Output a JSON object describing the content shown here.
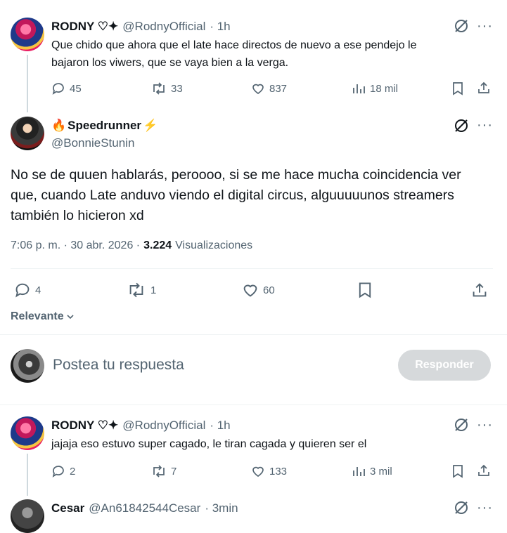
{
  "reply1": {
    "name": "RODNY ♡✦",
    "handle": "@RodnyOfficial",
    "time": "· 1h",
    "text_line1": "Que chido que ahora que el late hace directos de nuevo a ese pendejo le",
    "text_line2": "bajaron los viwers, que se vaya bien a la verga.",
    "replies": "45",
    "reposts": "33",
    "likes": "837",
    "views": "18 mil"
  },
  "main": {
    "name": "Speedrunner",
    "name_prefix": "🔥",
    "name_suffix": "⚡",
    "handle": "@BonnieStunin",
    "text_line1": "No se de quuen hablarás, peroooo, si se me hace mucha coincidencia ver",
    "text_line2": "que, cuando Late anduvo viendo el digital circus, alguuuuunos streamers",
    "text_line3": "también lo hicieron xd",
    "timestamp": "7:06 p. m. · 30 abr. 2026 ·",
    "views_count": "3.224",
    "views_label": "Visualizaciones",
    "replies": "4",
    "reposts": "1",
    "likes": "60"
  },
  "sort": {
    "label": "Relevante"
  },
  "composer": {
    "placeholder": "Postea tu respuesta",
    "button": "Responder"
  },
  "reply2": {
    "name": "RODNY ♡✦",
    "handle": "@RodnyOfficial",
    "time": "· 1h",
    "text": "jajaja eso estuvo super cagado, le tiran cagada y quieren ser el",
    "replies": "2",
    "reposts": "7",
    "likes": "133",
    "views": "3 mil"
  },
  "reply3": {
    "name": "Cesar",
    "handle": "@An61842544Cesar",
    "time": "· 3min"
  }
}
